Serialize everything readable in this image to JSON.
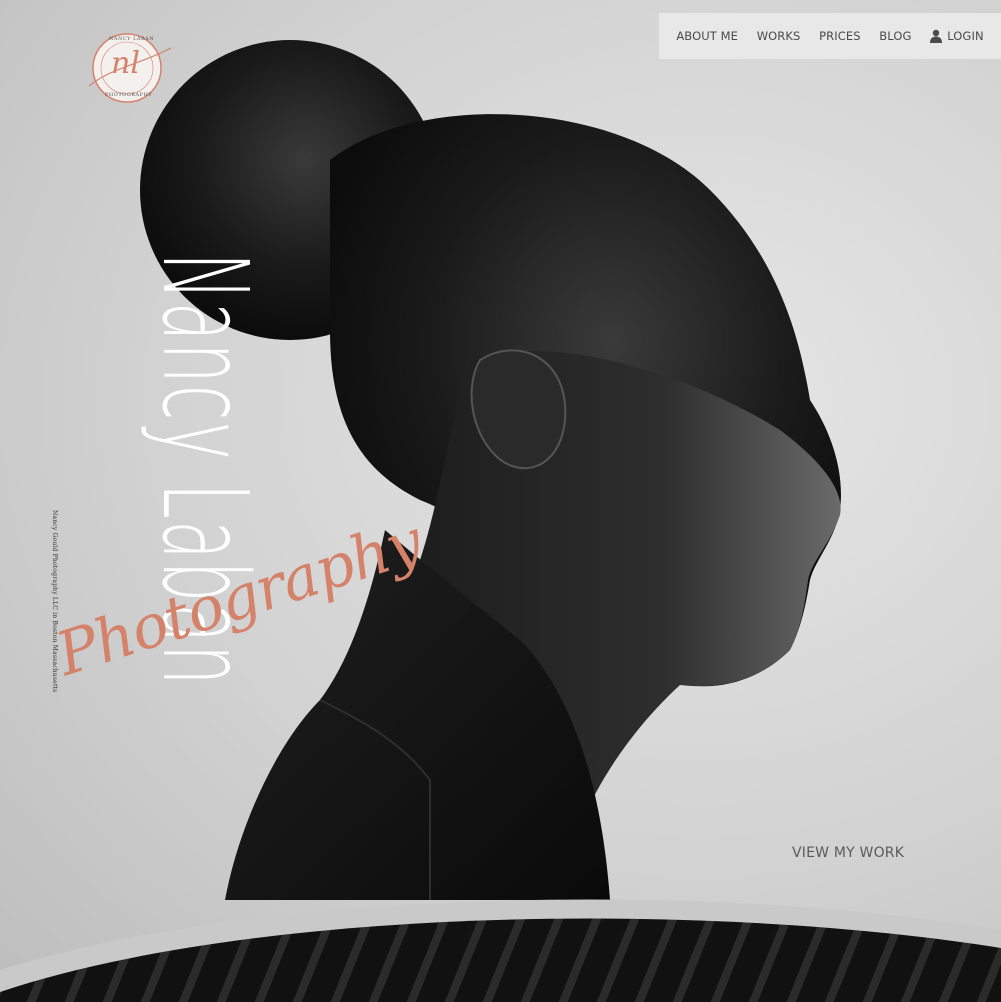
{
  "nav": {
    "items": [
      "ABOUT ME",
      "WORKS",
      "PRICES",
      "BLOG"
    ],
    "login_label": "LOGIN"
  },
  "logo": {
    "initials": "nl",
    "top_text": "NANCY LABAN",
    "bottom_text": "PHOTOGRAPHY",
    "accent_color": "#d4826a"
  },
  "hero": {
    "name": "Nancy Laban",
    "script_text": "Photography",
    "tagline": "Nancy Gould Photography LLC in Boston Massachusetts",
    "cta_label": "VIEW MY WORK"
  },
  "colors": {
    "accent": "#d4826a",
    "nav_bg": "#e8e8e8",
    "nav_text": "#4a4a4a"
  }
}
